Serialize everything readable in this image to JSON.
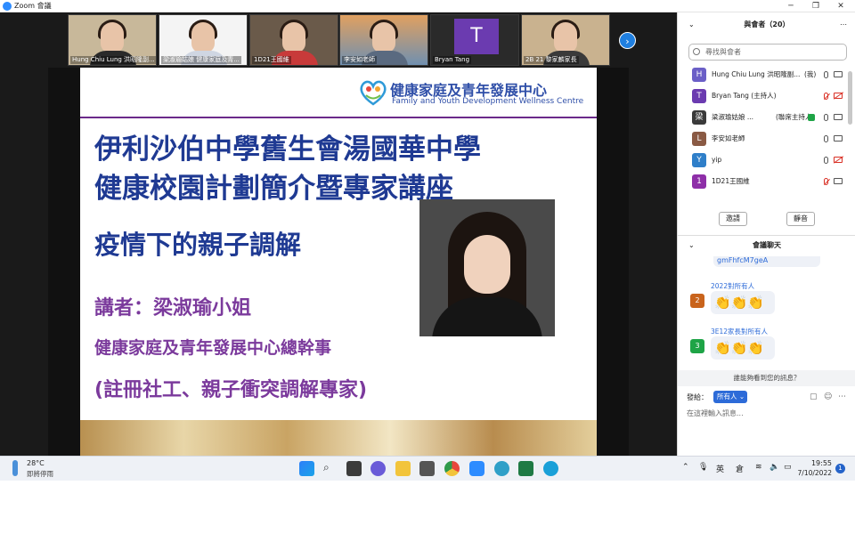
{
  "window": {
    "title": "Zoom 會議",
    "min_icon": "minimize-icon",
    "max_icon": "maximize-icon",
    "close_icon": "close-icon",
    "min": "─",
    "max": "❐",
    "close": "✕"
  },
  "thumbnails": [
    {
      "name": "Hung Chiu Lung 洪昭隆副...",
      "kind": "video"
    },
    {
      "name": "梁淑瑜姑娘 健康家庭及青...",
      "kind": "video"
    },
    {
      "name": "1D21王國維",
      "kind": "video"
    },
    {
      "name": "李安如老師",
      "kind": "video"
    },
    {
      "name": "Bryan Tang",
      "kind": "initial",
      "initial": "T"
    },
    {
      "name": "2B 21 黎家麟家長",
      "kind": "video"
    }
  ],
  "next_button": "›",
  "slide": {
    "org_name_zh": "健康家庭及青年發展中心",
    "org_name_en": "Family and Youth Development Wellness Centre",
    "title_line1": "伊利沙伯中學舊生會湯國華中學",
    "title_line2": "健康校園計劃簡介暨專家講座",
    "topic": "疫情下的親子調解",
    "speaker": "講者：梁淑瑜小姐",
    "role": "健康家庭及青年發展中心總幹事",
    "credentials": "(註冊社工、親子衝突調解專家)"
  },
  "participants_panel": {
    "header": "與會者（20）",
    "search_placeholder": "尋找與會者",
    "items": [
      {
        "initial": "H",
        "color": "#6b5fc7",
        "name": "Hung Chiu Lung 洪昭隆副...",
        "role": "(我)",
        "mic": "on",
        "cam": "on"
      },
      {
        "initial": "T",
        "color": "#6b3bb0",
        "name": "Bryan Tang (主持人)",
        "role": "",
        "mic": "muted",
        "cam": "off"
      },
      {
        "initial": "梁",
        "color": "#3a3a3a",
        "name": "梁淑瑜姑娘 ...",
        "role": "(聯席主持人)",
        "mic": "on",
        "cam": "on"
      },
      {
        "initial": "L",
        "color": "#8a5a44",
        "name": "李安如老師",
        "role": "",
        "mic": "on",
        "cam": "on"
      },
      {
        "initial": "Y",
        "color": "#2f7fc9",
        "name": "yip",
        "role": "",
        "mic": "on",
        "cam": "off"
      },
      {
        "initial": "1",
        "color": "#8e2fa8",
        "name": "1D21王國維",
        "role": "",
        "mic": "muted",
        "cam": "on"
      }
    ],
    "invite_label": "邀請",
    "mute_all_label": "靜音"
  },
  "chat_panel": {
    "header": "會議聊天",
    "link_fragment": "gmFhfcM7geA",
    "messages": [
      {
        "initial": "2",
        "avatar_color": "#c9641c",
        "header": "2022對所有人",
        "body": "👏👏👏"
      },
      {
        "initial": "3",
        "avatar_color": "#1ea446",
        "header": "3E12家長對所有人",
        "body": "👏👏👏"
      }
    ],
    "hint": "誰能夠看到您的訊息？",
    "send_to_label": "發給：",
    "send_to_value": "所有人 ⌄",
    "input_placeholder": "在這裡輸入訊息..."
  },
  "taskbar": {
    "temperature": "28°C",
    "weather": "即將停雨",
    "tray_lang": "英",
    "tray_ime": "倉",
    "time": "19:55",
    "date": "7/10/2022",
    "notifications": "1"
  }
}
